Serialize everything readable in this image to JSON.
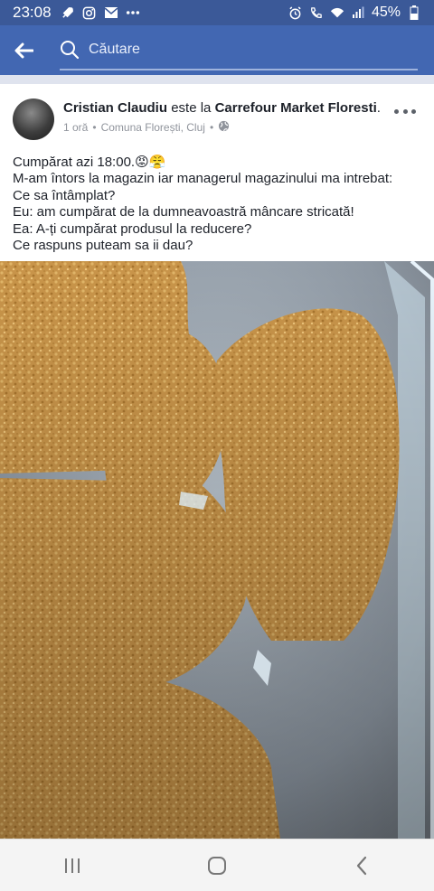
{
  "status_bar": {
    "time": "23:08",
    "left_icons": [
      "rocket-icon",
      "instagram-icon",
      "mail-icon",
      "more-dots-icon"
    ],
    "right_icons": [
      "alarm-icon",
      "call-icon",
      "wifi-icon",
      "signal-icon",
      "battery-icon"
    ],
    "battery": "45%"
  },
  "topbar": {
    "search_placeholder": "Căutare",
    "background": "#4267b2"
  },
  "post": {
    "author": "Cristian Claudiu",
    "connector": "este la",
    "place": "Carrefour  Market Floresti",
    "time": "1 oră",
    "location": "Comuna Florești, Cluj",
    "privacy_icon": "globe-icon",
    "lines": [
      "Cumpărat azi 18:00.😡😤",
      "M-am întors la magazin iar managerul magazinului ma intrebat:",
      "Ce sa întâmplat?",
      "Eu: am cumpărat de la dumneavoastră mâncare stricată!",
      "Ea: A-ți cumpărat produsul la reducere?",
      "Ce raspuns puteam sa ii dau?"
    ],
    "photo_description_icon": "photo-breaded-fish"
  },
  "navbar": {
    "buttons": [
      "recent-apps-icon",
      "home-icon",
      "back-icon"
    ]
  }
}
